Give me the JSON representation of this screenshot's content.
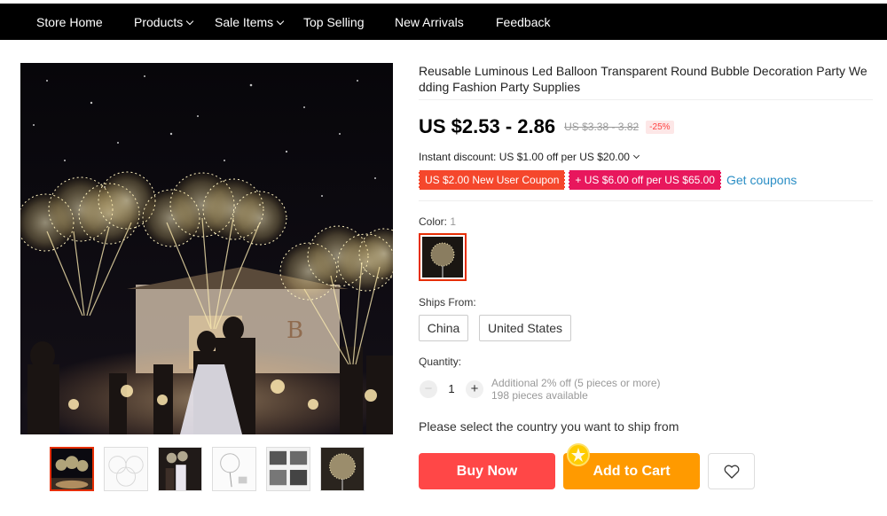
{
  "nav": {
    "items": [
      {
        "label": "Store Home",
        "dropdown": false
      },
      {
        "label": "Products",
        "dropdown": true
      },
      {
        "label": "Sale Items",
        "dropdown": true
      },
      {
        "label": "Top Selling",
        "dropdown": false
      },
      {
        "label": "New Arrivals",
        "dropdown": false
      },
      {
        "label": "Feedback",
        "dropdown": false
      }
    ]
  },
  "product": {
    "title": "Reusable Luminous Led Balloon Transparent Round Bubble Decoration Party Wedding Fashion Party Supplies",
    "price": "US $2.53 - 2.86",
    "original_price": "US $3.38 - 3.82",
    "discount": "-25%",
    "instant_discount": "Instant discount: US $1.00 off per US $20.00",
    "coupons": {
      "new_user": "US $2.00 New User Coupon",
      "store": "+ US $6.00 off per US $65.00",
      "get_coupons": "Get coupons"
    },
    "color": {
      "label": "Color:",
      "count": "1"
    },
    "ships_from": {
      "label": "Ships From:",
      "options": [
        "China",
        "United States"
      ]
    },
    "quantity": {
      "label": "Quantity:",
      "value": "1",
      "minus": "−",
      "plus": "+",
      "note_line1": "Additional 2% off (5 pieces or more)",
      "note_line2": "198 pieces available"
    },
    "ship_message": "Please select the country you want to ship from",
    "actions": {
      "buy_now": "Buy Now",
      "add_to_cart": "Add to Cart"
    }
  },
  "colors": {
    "nav_bg": "#000000",
    "price_discount": "#ff4747",
    "buy_now": "#ff4747",
    "add_to_cart": "#ff9a00",
    "link": "#2a8ec5",
    "selected_border": "#e62e04"
  },
  "icons": {
    "nav_dropdown": "chevron-down-icon",
    "instant_dropdown": "chevron-down-icon",
    "wishlist": "heart-icon",
    "cart_badge": "coin-icon"
  }
}
